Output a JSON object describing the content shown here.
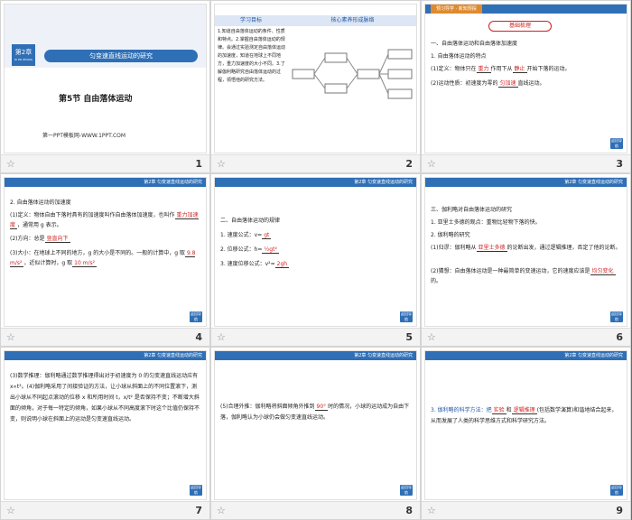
{
  "slides": [
    {
      "num": "1",
      "star": "☆",
      "chapter_badge": "第2章",
      "badge_sub": "DI ER ZHANG",
      "title": "匀变速直线运动的研究",
      "section": "第5节   自由落体运动",
      "footer": "第一PPT模板网-WWW.1PPT.COM"
    },
    {
      "num": "2",
      "star": "☆",
      "col1": "学习目标",
      "col2": "核心素养形成脉络",
      "goals": "1.知道自由落体运动的条件、性质和特点。2.掌握自由落体运动的规律。会通过实验测定自由落体运动的加速度，知道在地球上不同地方，重力加速度的大小不同。3.了解伽利略研究自由落体运动的过程，领悟他的研究方法。"
    },
    {
      "num": "3",
      "star": "☆",
      "tab": "预习导学 · 新知预探",
      "heading": "基础梳理",
      "h1": "一、自由落体运动和自由落体加速度",
      "h2": "1. 自由落体运动的特点",
      "l1a": "(1)定义：物体只在",
      "l1b": "重力",
      "l1c": "作用下从",
      "l1d": "静止",
      "l1e": "开始下落的运动。",
      "l2a": "(2)运动性质：初速度为零的",
      "l2b": "匀加速",
      "l2c": "直线运动。"
    },
    {
      "num": "4",
      "star": "☆",
      "h": "2. 自由落体运动的加速度",
      "a1": "(1)定义：物体自由下落时具有的加速度叫作自由落体加速度，也叫作",
      "a1b": "重力加速度",
      "a1c": "，通常用 g 表示。",
      "a2": "(2)方向：总是",
      "a2b": "竖直向下",
      "a3": "(3)大小：在地球上不同的地方，g 的大小是不同的。一般的计算中，g 取",
      "a3b": "9.8 m/s²",
      "a3c": "，近似计算时，g 取",
      "a3d": "10 m/s²"
    },
    {
      "num": "5",
      "star": "☆",
      "h": "二、自由落体运动的规律",
      "f1": "1. 速度公式：v=",
      "f1v": "gt",
      "f2": "2. 位移公式：h=",
      "f2v": "½gt²",
      "f3": "3. 速度位移公式：v²=",
      "f3v": "2gh"
    },
    {
      "num": "6",
      "star": "☆",
      "h": "三、伽利略对自由落体运动的研究",
      "p1": "1. 亚里士多德的观点：重物比轻物下落的快。",
      "p2": "2. 伽利略的研究",
      "p3": "(1)归谬：伽利略从",
      "p3b": "亚里士多德",
      "p3c": "的论断出发，通过逻辑推理，否定了他的论断。",
      "p4": "(2)猜想：自由落体运动是一种最简单的变速运动，它的速度应该是",
      "p4b": "均匀变化",
      "p4c": "的。"
    },
    {
      "num": "7",
      "star": "☆",
      "text": "(3)数学推理：伽利略通过数学推理得出对于初速度为 0 的匀变速直线运动应有 x∝t²。(4)伽利略采用了间接验证的方法，让小球从斜面上的不同位置滚下，测出小球从不同起点滚动的位移 x 和所用时间 t，x/t² 是否保持不变；不断增大斜面的倾角，对于每一特定的倾角，如果小球从不同高度滚下时这个比值仍保持不变，则说明小球在斜面上的运动是匀变速直线运动。"
    },
    {
      "num": "8",
      "star": "☆",
      "text": "(5)合理外推：伽利略将斜面倾角外推到",
      "angle": "90°",
      "text2": "时的情况，小球的运动成为自由下落，伽利略认为小球仍会做匀变速直线运动。"
    },
    {
      "num": "9",
      "star": "☆",
      "m1": "3. 伽利略的科学方法：把",
      "m1b": "实验",
      "m1c": "和",
      "m1d": "逻辑推理",
      "m1e": "(包括数学演算)和谐地结合起来，从而发展了人类的科学思维方式和科学研究方法。"
    }
  ],
  "header_text": "第2章 匀变速直线运动的研究",
  "back_label": "返回导航",
  "colors": {
    "accent": "#2f6fb6",
    "red": "#d21f1f"
  }
}
